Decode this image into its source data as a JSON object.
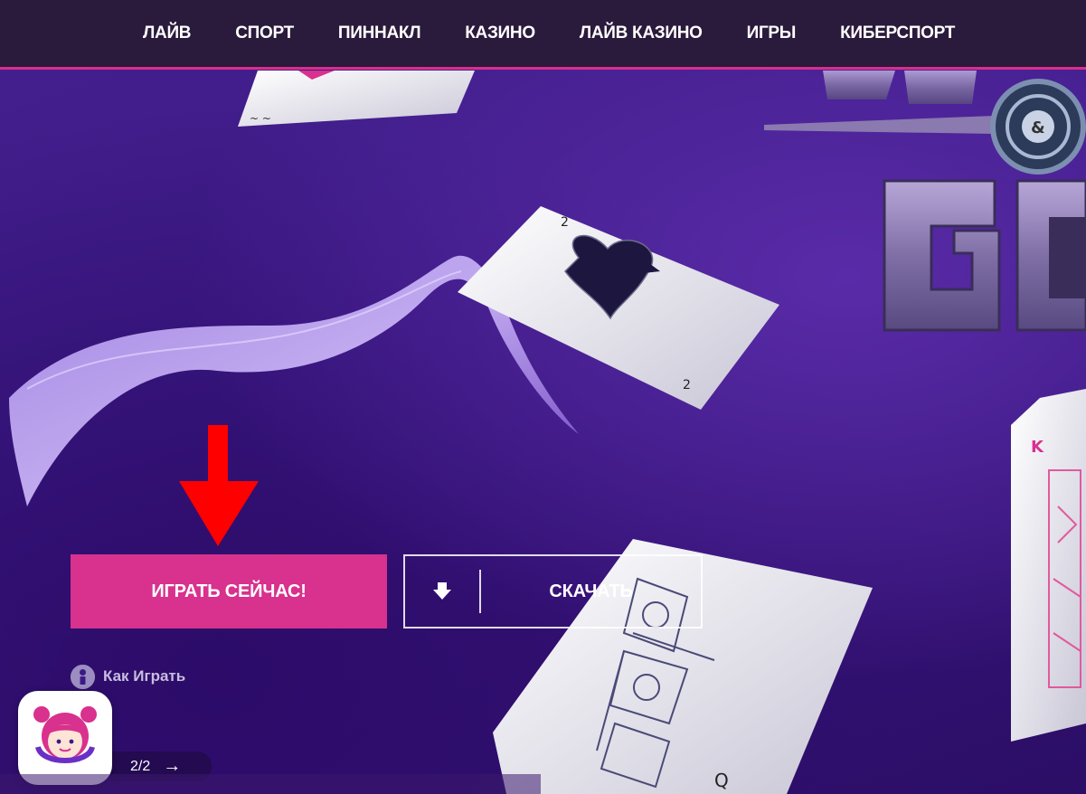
{
  "nav": {
    "items": [
      {
        "label": "ЛАЙВ"
      },
      {
        "label": "СПОРТ"
      },
      {
        "label": "ПИННАКЛ"
      },
      {
        "label": "КАЗИНО"
      },
      {
        "label": "ЛАЙВ КАЗИНО"
      },
      {
        "label": "ИГРЫ"
      },
      {
        "label": "КИБЕРСПОРТ"
      }
    ]
  },
  "hero": {
    "play_label": "ИГРАТЬ СЕЙЧАС!",
    "download_label": "СКАЧАТЬ",
    "download_icon": "download-arrow-icon",
    "howto_label": "Как Играть",
    "howto_icon": "info-icon"
  },
  "pager": {
    "count": "2/2",
    "next": "→"
  },
  "colors": {
    "accent": "#d8318e",
    "nav_bg": "#2a1a3b",
    "hero_bg": "#3b1a85",
    "annotation_arrow": "#ff0000"
  }
}
